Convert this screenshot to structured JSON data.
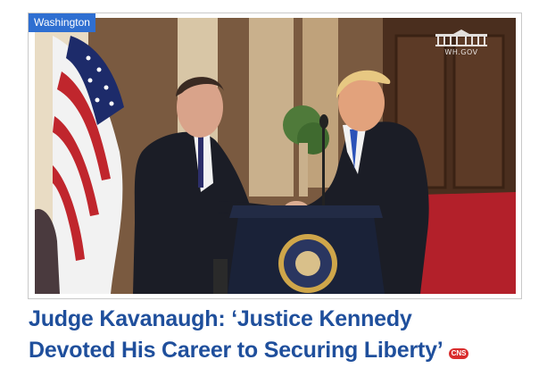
{
  "category_tag": "Washington",
  "watermark": "WH.GOV",
  "headline": {
    "line1": "Judge Kavanaugh: ‘Justice Kennedy",
    "line2": "Devoted His Career to Securing Liberty’"
  },
  "source_badge": "CNS",
  "colors": {
    "tag_bg": "#2f6fd1",
    "headline": "#1f4f9c",
    "badge_bg": "#d92d2d",
    "carpet": "#b3202a",
    "suit": "#1b1d26"
  }
}
